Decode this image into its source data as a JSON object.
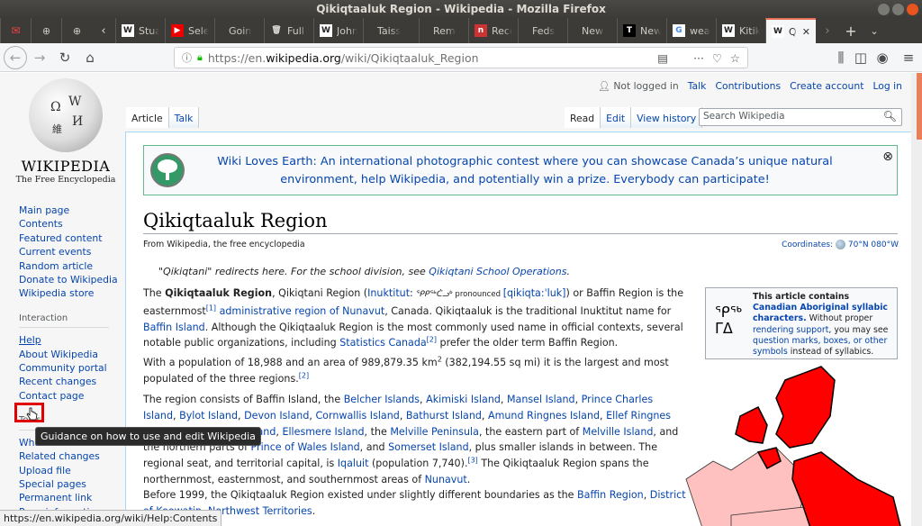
{
  "window": {
    "title": "Qikiqtaaluk Region - Wikipedia - Mozilla Firefox"
  },
  "tabs": [
    {
      "label": "Stuart",
      "icon": "wikipedia-icon"
    },
    {
      "label": "Selena",
      "icon": "youtube-icon"
    },
    {
      "label": "Going",
      "icon": "none"
    },
    {
      "label": "Full t",
      "icon": "trash-icon"
    },
    {
      "label": "John",
      "icon": "wikipedia-icon"
    },
    {
      "label": "Taissum",
      "icon": "none"
    },
    {
      "label": "Remem",
      "icon": "none"
    },
    {
      "label": "Reco",
      "icon": "news-icon"
    },
    {
      "label": "Feds re",
      "icon": "none"
    },
    {
      "label": "New bo",
      "icon": "none"
    },
    {
      "label": "New",
      "icon": "t-icon"
    },
    {
      "label": "weat",
      "icon": "google-icon"
    },
    {
      "label": "Kitik",
      "icon": "wikipedia-icon"
    },
    {
      "label": "Qi",
      "icon": "wikipedia-icon",
      "active": true
    }
  ],
  "navbar": {
    "url_prefix": "https://en.",
    "url_domain": "wikipedia.org",
    "url_path": "/wiki/Qikiqtaaluk_Region"
  },
  "wiki": {
    "wordmark": "Wikipedia",
    "tagline": "The Free Encyclopedia",
    "personal": {
      "not_logged_in": "Not logged in",
      "talk": "Talk",
      "contributions": "Contributions",
      "create_account": "Create account",
      "login": "Log in"
    },
    "namespaces": {
      "article": "Article",
      "talk": "Talk"
    },
    "views": {
      "read": "Read",
      "edit": "Edit",
      "history": "View history"
    },
    "search_placeholder": "Search Wikipedia",
    "sidebar": {
      "navigation": [
        "Main page",
        "Contents",
        "Featured content",
        "Current events",
        "Random article",
        "Donate to Wikipedia",
        "Wikipedia store"
      ],
      "interaction_heading": "Interaction",
      "interaction": [
        "Help",
        "About Wikipedia",
        "Community portal",
        "Recent changes",
        "Contact page"
      ],
      "tools_heading": "Tools",
      "tools": [
        "What links here",
        "Related changes",
        "Upload file",
        "Special pages",
        "Permanent link",
        "Page information"
      ]
    },
    "banner": "Wiki Loves Earth: An international photographic contest where you can showcase Canada’s unique natural environment, help Wikipedia, and potentially win a prize. Everybody can participate!",
    "title": "Qikiqtaaluk Region",
    "subtitle": "From Wikipedia, the free encyclopedia",
    "coordinates_label": "Coordinates:",
    "coordinates_value": "70°N 080°W",
    "hatnote_pre": "\"Qikiqtani\" redirects here. For the school division, see ",
    "hatnote_link": "Qikiqtani School Operations",
    "syllabics_box": {
      "glyph": "ᕿᑭᖅ ᑖᓗᒃ",
      "heading": "This article contains",
      "link_bold": "Canadian Aboriginal syllabic characters.",
      "text1": " Without proper ",
      "link2": "rendering support",
      "text2": ", you may see ",
      "link3": "question marks, boxes, or other symbols",
      "text3": " instead of syllabics."
    },
    "p1": {
      "t1": "The ",
      "b1": "Qikiqtaaluk Region",
      "t2": ", Qikiqtani Region (",
      "l1": "Inuktitut",
      "t3": ": ",
      "syl": "ᕿᑭᖅᑖᓗᒃ",
      "small": " pronounced ",
      "l2": "[qikiqta:ˈluk]",
      "t4": ") or Baffin Region is the easternmost",
      "s1": "[1]",
      "l3": "administrative region of Nunavut",
      "t5": ", Canada. Qikiqtaaluk is the traditional Inuktitut name for ",
      "l4": "Baffin Island",
      "t6": ". Although the Qikiqtaaluk Region is the most commonly used name in official contexts, several notable public organizations, including ",
      "l5": "Statistics Canada",
      "s2": "[2]",
      "t7": " prefer the older term Baffin Region."
    },
    "p2": {
      "t1": "With a population of 18,988 and an area of 989,879.35 km",
      "sup": "2",
      "t2": " (382,194.55 sq mi) it is the largest and most populated of the three regions.",
      "s1": "[2]"
    },
    "p3": {
      "t1": "The region consists of Baffin Island, the ",
      "links": [
        "Belcher Islands",
        "Akimiski Island",
        "Mansel Island",
        "Prince Charles Island",
        "Bylot Island",
        "Devon Island",
        "Cornwallis Island",
        "Bathurst Island",
        "Amund Ringnes Island",
        "Ellef Ringnes Island",
        "Axel Heiberg Island",
        "Ellesmere Island"
      ],
      "t2": ", the ",
      "l_melp": "Melville Peninsula",
      "t3": ", the eastern part of ",
      "l_meli": "Melville Island",
      "t4": ", and the northern parts of ",
      "l_pow": "Prince of Wales Island",
      "t5": ", and ",
      "l_som": "Somerset Island",
      "t6": ", plus smaller islands in between. The regional seat, and territorial capital, is ",
      "l_iq": "Iqaluit",
      "t7": " (population 7,740).",
      "s1": "[3]",
      "t8": " The Qikiqtaaluk Region spans the northernmost, easternmost, and southernmost areas of ",
      "l_nun": "Nunavut",
      "t9": "."
    },
    "p4": {
      "t1": "Before 1999, the Qikiqtaaluk Region existed under slightly different boundaries as the ",
      "l1": "Baffin Region",
      "t2": ", ",
      "l2": "District of Keewatin",
      "t3": ", ",
      "l3": "Northwest Territories",
      "t4": "."
    }
  },
  "tooltip": "Guidance on how to use and edit Wikipedia",
  "status_url": "https://en.wikipedia.org/wiki/Help:Contents",
  "colors": {
    "link": "#0645ad",
    "accent_tab": "#e8735a",
    "map_region": "#ff0000",
    "map_other": "#ffc0c0",
    "highlight_box": "#e00000"
  }
}
